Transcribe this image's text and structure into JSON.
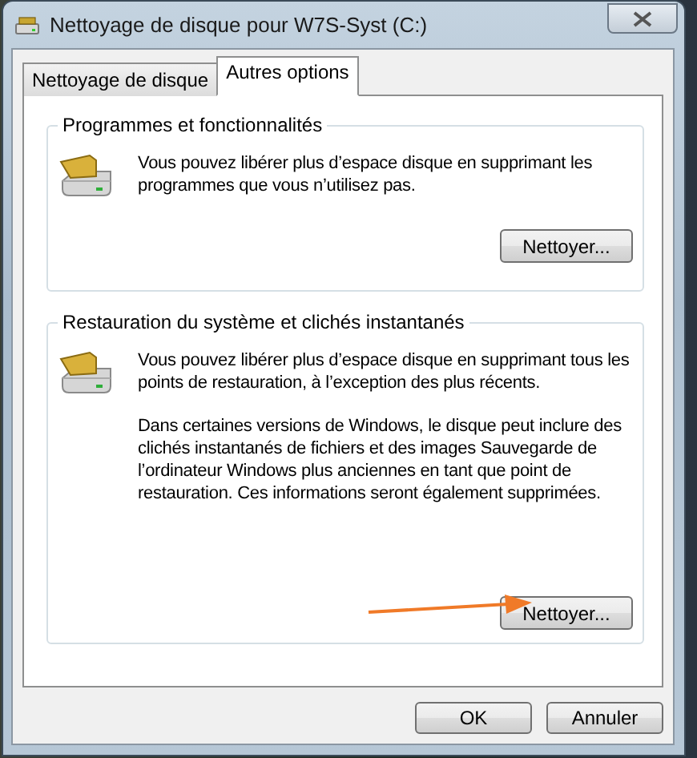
{
  "window": {
    "title": "Nettoyage de disque pour W7S-Syst (C:)"
  },
  "tabs": [
    {
      "label": "Nettoyage de disque",
      "selected": false
    },
    {
      "label": "Autres options",
      "selected": true
    }
  ],
  "groups": [
    {
      "title": "Programmes et fonctionnalités",
      "paragraphs": [
        "Vous pouvez libérer plus d’espace disque en supprimant les programmes que vous n’utilisez pas."
      ],
      "button": "Nettoyer..."
    },
    {
      "title": "Restauration du système et clichés instantanés",
      "paragraphs": [
        "Vous pouvez libérer plus d’espace disque en supprimant tous les points de restauration, à l’exception des plus récents.",
        "Dans certaines versions de Windows, le disque peut inclure des clichés instantanés de fichiers et des images Sauvegarde de l’ordinateur Windows plus anciennes en tant que point de restauration. Ces informations seront également supprimées."
      ],
      "button": "Nettoyer..."
    }
  ],
  "buttons": [
    "OK",
    "Annuler"
  ]
}
